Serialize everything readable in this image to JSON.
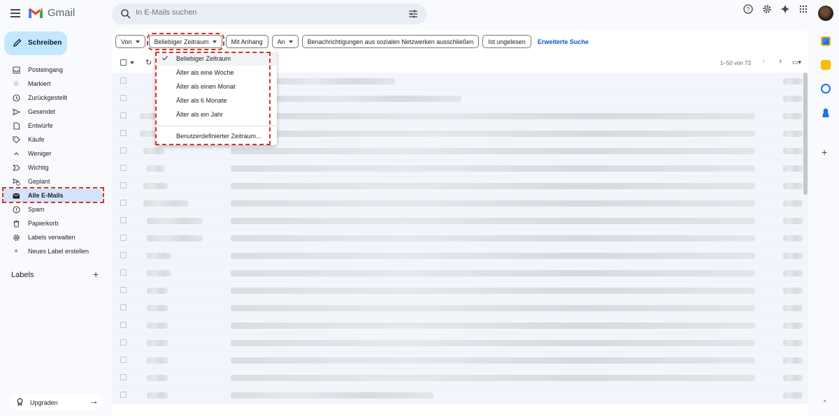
{
  "app": {
    "name": "Gmail"
  },
  "search": {
    "placeholder": "In E-Mails suchen"
  },
  "compose": {
    "label": "Schreiben"
  },
  "nav": {
    "items": [
      {
        "label": "Posteingang",
        "icon": "inbox-icon"
      },
      {
        "label": "Markiert",
        "icon": "star-icon"
      },
      {
        "label": "Zurückgestellt",
        "icon": "clock-icon"
      },
      {
        "label": "Gesendet",
        "icon": "send-icon"
      },
      {
        "label": "Entwürfe",
        "icon": "draft-icon"
      },
      {
        "label": "Käufe",
        "icon": "tag-icon"
      },
      {
        "label": "Weniger",
        "icon": "chevron-up-icon"
      },
      {
        "label": "Wichtig",
        "icon": "important-icon"
      },
      {
        "label": "Geplant",
        "icon": "scheduled-icon"
      },
      {
        "label": "Alle E-Mails",
        "icon": "all-mail-icon",
        "active": true
      },
      {
        "label": "Spam",
        "icon": "spam-icon"
      },
      {
        "label": "Papierkorb",
        "icon": "trash-icon"
      },
      {
        "label": "Labels verwalten",
        "icon": "gear-icon"
      },
      {
        "label": "Neues Label erstellen",
        "icon": "plus-icon"
      }
    ]
  },
  "labels": {
    "title": "Labels",
    "add": "+"
  },
  "upgrade": {
    "label": "Upgraden"
  },
  "filters": {
    "from": "Von",
    "time": "Beliebiger Zeitraum",
    "attachment": "Mit Anhang",
    "to": "An",
    "exclude_social": "Benachrichtigungen aus sozialen Netzwerken ausschließen",
    "unread": "Ist ungelesen",
    "advanced": "Erweiterte Suche"
  },
  "toolbar": {
    "pagination": "1–50 von 73"
  },
  "dropdown": {
    "items": [
      {
        "label": "Beliebiger Zeitraum",
        "checked": true
      },
      {
        "label": "Älter als eine Woche"
      },
      {
        "label": "Älter als einen Monat"
      },
      {
        "label": "Älter als 6 Monate"
      },
      {
        "label": "Älter als ein Jahr"
      }
    ],
    "custom": "Benutzerdefinierter Zeitraum..."
  },
  "colors": {
    "accent": "#0b57d0",
    "compose_bg": "#c2e7ff",
    "active_nav": "#d3e3fd",
    "highlight_outline": "#d93025"
  }
}
